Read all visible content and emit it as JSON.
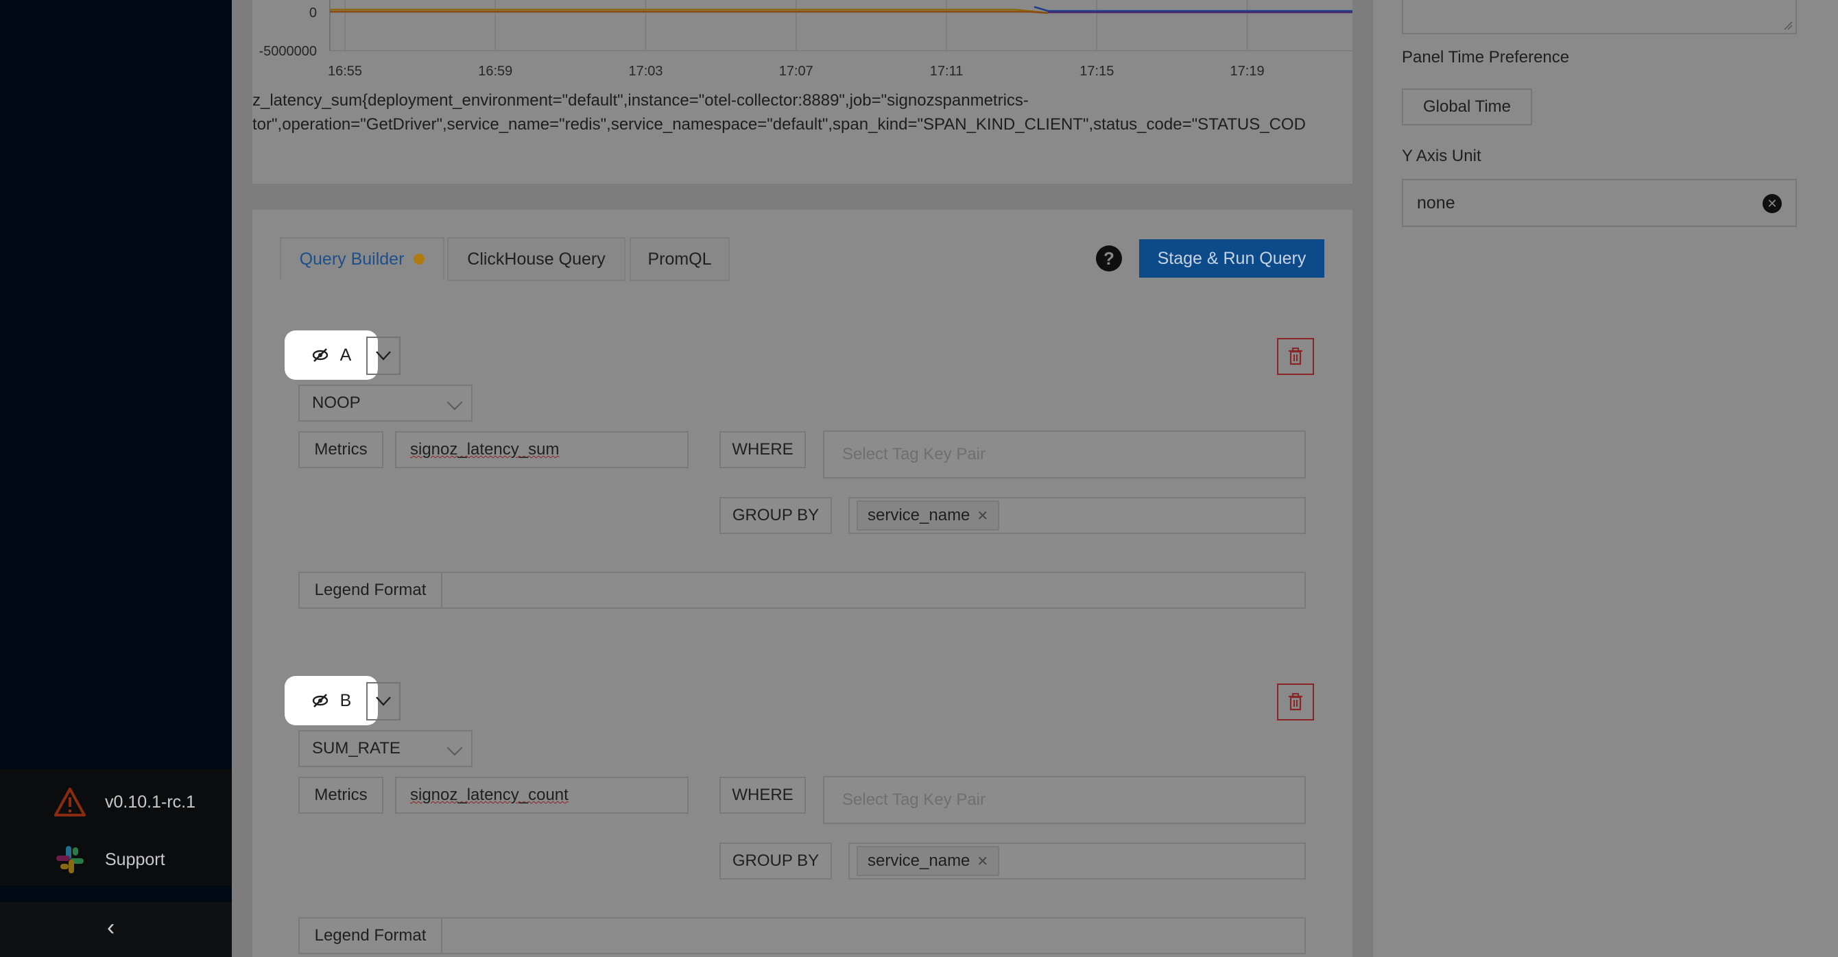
{
  "sidebar": {
    "version": "v0.10.1-rc.1",
    "support_label": "Support",
    "collapse_icon": "‹"
  },
  "chart": {
    "y_ticks": [
      "0",
      "-5000000"
    ],
    "x_ticks": [
      "16:55",
      "16:59",
      "17:03",
      "17:07",
      "17:11",
      "17:15",
      "17:19"
    ],
    "series_label_line1": "z_latency_sum{deployment_environment=\"default\",instance=\"otel-collector:8889\",job=\"signozspanmetrics-",
    "series_label_line2": "tor\",operation=\"GetDriver\",service_name=\"redis\",service_namespace=\"default\",span_kind=\"SPAN_KIND_CLIENT\",status_code=\"STATUS_COD"
  },
  "chart_data": {
    "type": "line",
    "x": [
      "16:55",
      "16:59",
      "17:03",
      "17:07",
      "17:11",
      "17:15",
      "17:19"
    ],
    "series": [
      {
        "name": "",
        "values": [
          0,
          0,
          0,
          0,
          0,
          0,
          0
        ]
      }
    ],
    "ylim": [
      -5000000,
      0
    ]
  },
  "tabs": {
    "query_builder": "Query Builder",
    "clickhouse": "ClickHouse Query",
    "promql": "PromQL"
  },
  "help_icon": "?",
  "run_button": "Stage & Run Query",
  "queries": [
    {
      "name": "A",
      "aggregation": "NOOP",
      "metrics_label": "Metrics",
      "metric": "signoz_latency_sum",
      "where_label": "WHERE",
      "where_placeholder": "Select Tag Key Pair",
      "group_by_label": "GROUP BY",
      "group_by_tag": "service_name",
      "legend_label": "Legend Format",
      "legend_value": ""
    },
    {
      "name": "B",
      "aggregation": "SUM_RATE",
      "metrics_label": "Metrics",
      "metric": "signoz_latency_count",
      "where_label": "WHERE",
      "where_placeholder": "Select Tag Key Pair",
      "group_by_label": "GROUP BY",
      "group_by_tag": "service_name",
      "legend_label": "Legend Format",
      "legend_value": ""
    }
  ],
  "right_panel": {
    "time_pref_label": "Panel Time Preference",
    "time_pref_value": "Global Time",
    "y_axis_label": "Y Axis Unit",
    "y_axis_value": "none"
  },
  "colors": {
    "accent": "#0c4a8a",
    "danger": "#8a2525",
    "sidebar_bg": "#000a14"
  }
}
